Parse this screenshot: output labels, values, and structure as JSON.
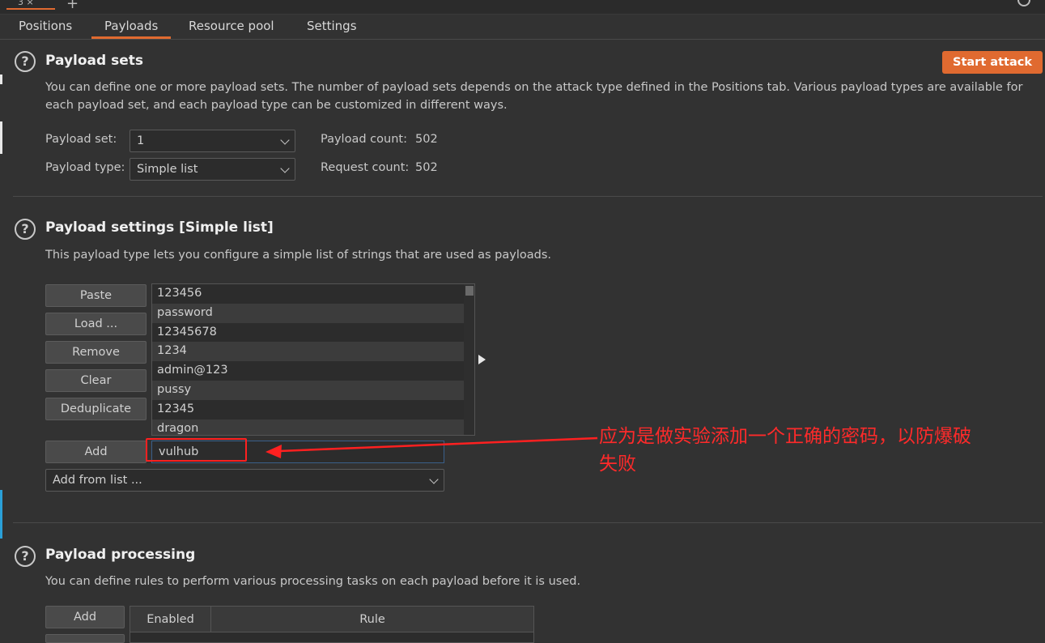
{
  "tabs": [
    "Positions",
    "Payloads",
    "Resource pool",
    "Settings"
  ],
  "payload_sets": {
    "title": "Payload sets",
    "description_line1": "You can define one or more payload sets. The number of payload sets depends on the attack type defined in the Positions tab. Various payload types are available for",
    "description_line2": "each payload set, and each payload type can be customized in different ways.",
    "start_attack": "Start attack",
    "payload_set_label": "Payload set:",
    "payload_set_value": "1",
    "payload_type_label": "Payload type:",
    "payload_type_value": "Simple list",
    "payload_count_label": "Payload count:",
    "payload_count_value": "502",
    "request_count_label": "Request count:",
    "request_count_value": "502"
  },
  "payload_settings": {
    "title": "Payload settings [Simple list]",
    "description": "This payload type lets you configure a simple list of strings that are used as payloads.",
    "buttons": {
      "paste": "Paste",
      "load": "Load ...",
      "remove": "Remove",
      "clear": "Clear",
      "deduplicate": "Deduplicate",
      "add": "Add"
    },
    "items": [
      "123456",
      "password",
      "12345678",
      "1234",
      "admin@123",
      "pussy",
      "12345",
      "dragon"
    ],
    "add_value": "vulhub",
    "add_from_list": "Add from list ..."
  },
  "annotation": {
    "line1": "应为是做实验添加一个正确的密码，以防爆破",
    "line2": "失败",
    "color": "#ff2a2a"
  },
  "payload_processing": {
    "title": "Payload processing",
    "description": "You can define rules to perform various processing tasks on each payload before it is used.",
    "add_button": "Add",
    "columns": [
      "Enabled",
      "Rule"
    ]
  },
  "colors": {
    "accent": "#e06a30",
    "background": "#323232"
  }
}
